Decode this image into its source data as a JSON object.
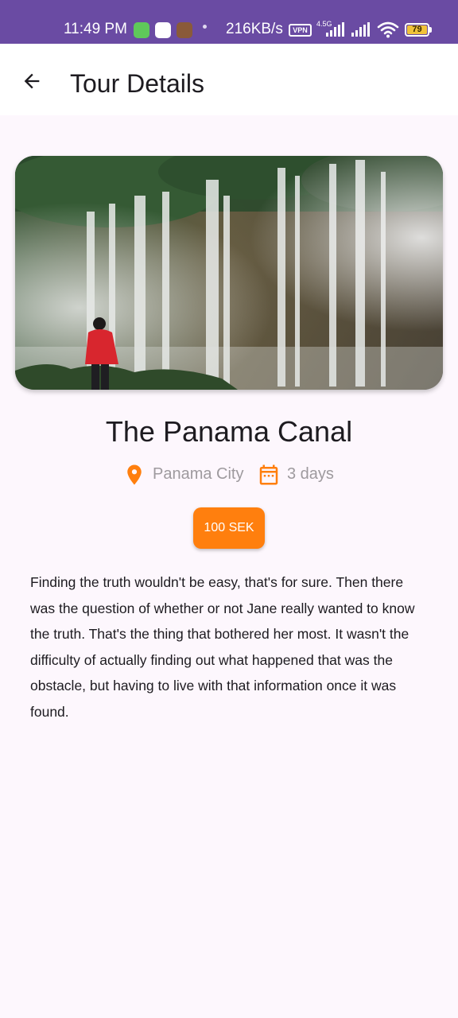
{
  "status_bar": {
    "time": "11:49 PM",
    "network_speed": "216KB/s",
    "vpn_label": "VPN",
    "network_type": "4.5G",
    "battery_level": "79",
    "colors": {
      "background": "#6a4ba3",
      "battery": "#f0c23a"
    },
    "icons": [
      "notification-app-icon",
      "v-app-icon",
      "game-app-icon",
      "signal-icon",
      "signal-icon",
      "wifi-icon",
      "battery-icon"
    ]
  },
  "app_bar": {
    "title": "Tour Details",
    "back_icon": "arrow-left-icon"
  },
  "tour": {
    "image_icon": "waterfall-photo",
    "title": "The Panama Canal",
    "location": "Panama City",
    "location_icon": "map-pin-icon",
    "duration": "3 days",
    "duration_icon": "calendar-icon",
    "price": "100 SEK",
    "description": "Finding the truth wouldn't be easy, that's for sure. Then there was the question of whether or not Jane really wanted to know the truth. That's the thing that bothered her most. It wasn't the difficulty of actually finding out what happened that was the obstacle, but having to live with that information once it was found."
  },
  "colors": {
    "accent": "#ff7f0e",
    "background": "#fdf7fd",
    "muted_text": "#9e9a9e"
  }
}
